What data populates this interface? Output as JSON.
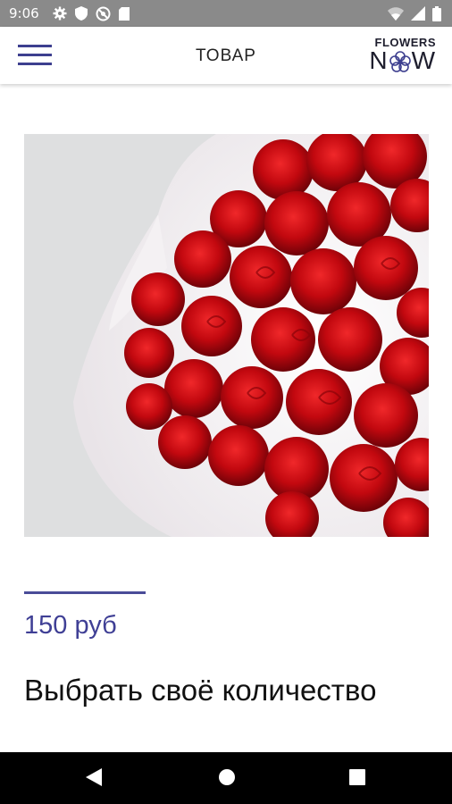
{
  "status_bar": {
    "time": "9:06",
    "left_icons": [
      "gear-icon",
      "shield-icon",
      "no-sync-icon",
      "sd-card-icon"
    ],
    "right_icons": [
      "wifi-icon",
      "signal-icon",
      "battery-icon"
    ],
    "background": "#8a8a8a"
  },
  "app_bar": {
    "title": "ТОВАР",
    "menu_icon": "hamburger-icon",
    "logo_top": "FLOWERS",
    "logo_bottom_left": "N",
    "logo_bottom_right": "W",
    "accent_color": "#3d3f8f"
  },
  "product": {
    "image_subject": "bouquet of red roses",
    "price": "150 руб",
    "title": "Выбрать своё количество"
  },
  "nav_bar": {
    "icons": [
      "back-icon",
      "home-icon",
      "recents-icon"
    ]
  }
}
